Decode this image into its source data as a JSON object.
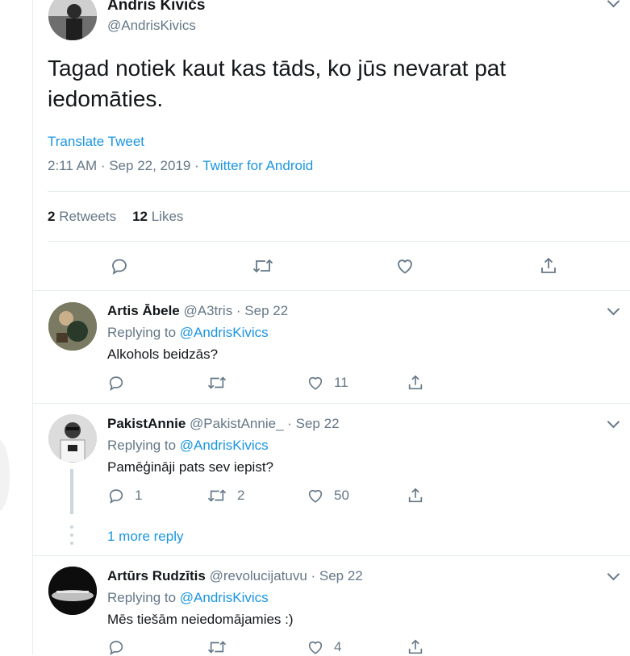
{
  "main": {
    "name": "Andris Kivičs",
    "handle": "@AndrisKivics",
    "text": "Tagad notiek kaut kas tāds, ko jūs nevarat pat iedomāties.",
    "translate": "Translate Tweet",
    "time": "2:11 AM · Sep 22, 2019 · ",
    "source": "Twitter for Android",
    "retweets_count": "2",
    "retweets_label": "Retweets",
    "likes_count": "12",
    "likes_label": "Likes"
  },
  "replies": [
    {
      "name": "Artis Ābele",
      "meta": "@A3tris · Sep 22",
      "replying": "Replying to ",
      "to": "@AndrisKivics",
      "text": "Alkohols beidzās?",
      "reply_count": "",
      "retweet_count": "",
      "like_count": "11"
    },
    {
      "name": "PakistAnnie",
      "meta": "@PakistAnnie_ · Sep 22",
      "replying": "Replying to ",
      "to": "@AndrisKivics",
      "text": "Pamēģināji pats sev iepist?",
      "reply_count": "1",
      "retweet_count": "2",
      "like_count": "50"
    },
    {
      "name": "Artūrs Rudzītis",
      "meta": "@revolucijatuvu · Sep 22",
      "replying": "Replying to ",
      "to": "@AndrisKivics",
      "text": "Mēs tiešām neiedomājamies :)",
      "reply_count": "",
      "retweet_count": "",
      "like_count": "4"
    }
  ],
  "more_reply": "1 more reply",
  "colors": {
    "accent": "#1b95e0",
    "muted": "#657786",
    "border": "#e6ecf0",
    "text": "#14171a"
  }
}
